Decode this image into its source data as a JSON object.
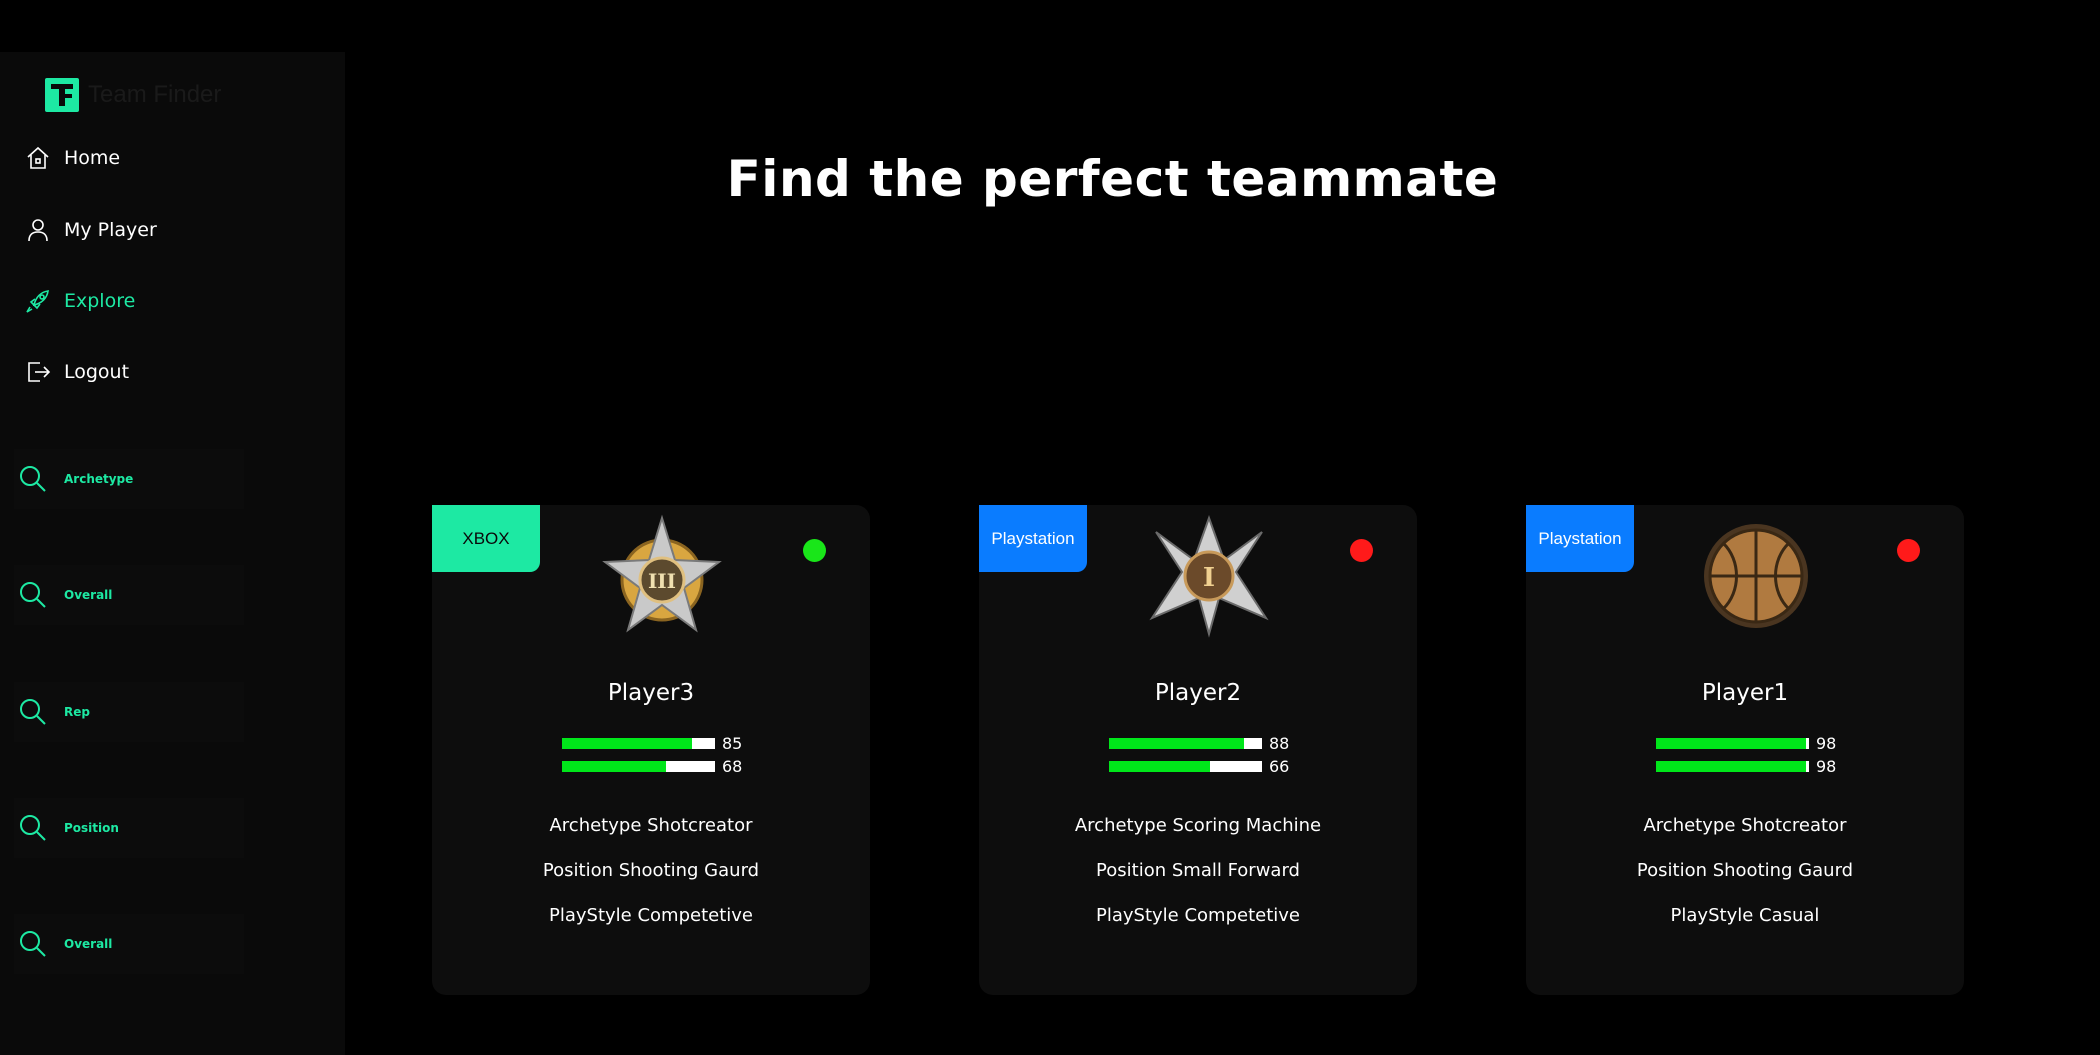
{
  "app": {
    "name": "Team Finder",
    "logo_letter": "F"
  },
  "nav": {
    "items": [
      {
        "label": "Home",
        "icon": "home-icon",
        "active": false
      },
      {
        "label": "My Player",
        "icon": "user-icon",
        "active": false
      },
      {
        "label": "Explore",
        "icon": "rocket-icon",
        "active": true
      },
      {
        "label": "Logout",
        "icon": "logout-icon",
        "active": false
      }
    ]
  },
  "filters": [
    {
      "label": "Archetype",
      "icon": "search-icon"
    },
    {
      "label": "Overall",
      "icon": "search-icon"
    },
    {
      "label": "Rep",
      "icon": "search-icon"
    },
    {
      "label": "Position",
      "icon": "search-icon"
    },
    {
      "label": "Overall",
      "icon": "search-icon"
    }
  ],
  "hero": {
    "title": "Find the perfect teammate"
  },
  "cards": [
    {
      "platform": "XBOX",
      "platform_color": "#1de9a3",
      "badge": "star-badge-icon",
      "status_color": "#19e619",
      "name": "Player3",
      "stat1": 85,
      "stat2": 68,
      "archetype": "Archetype Shotcreator",
      "position": "Position Shooting Gaurd",
      "playstyle": "PlayStyle Competetive"
    },
    {
      "platform": "Playstation",
      "platform_color": "#0a7cff",
      "badge": "silver-star-badge-icon",
      "status_color": "#ff1a1a",
      "name": "Player2",
      "stat1": 88,
      "stat2": 66,
      "archetype": "Archetype Scoring Machine",
      "position": "Position Small Forward",
      "playstyle": "PlayStyle Competetive"
    },
    {
      "platform": "Playstation",
      "platform_color": "#0a7cff",
      "badge": "basketball-badge-icon",
      "status_color": "#ff1a1a",
      "name": "Player1",
      "stat1": 98,
      "stat2": 98,
      "archetype": "Archetype Shotcreator",
      "position": "Position Shooting Gaurd",
      "playstyle": "PlayStyle Casual"
    }
  ],
  "colors": {
    "accent": "#1de9a3",
    "background": "#000000",
    "sidebar": "#0a0a0a",
    "card": "#0d0d0d",
    "stat_bar": "#00e61a"
  }
}
